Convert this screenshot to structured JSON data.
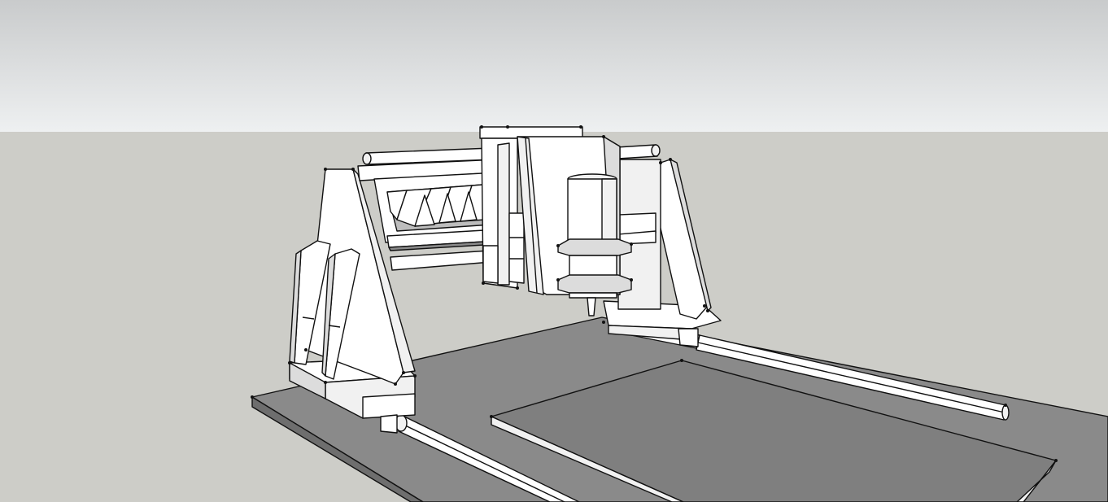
{
  "scene": {
    "subject": "cnc-router-3d-model",
    "colors": {
      "sky_top": "#c9cbcc",
      "sky_bottom": "#eef0f1",
      "ground": "#cdcdc8",
      "base_plate": "#808080",
      "work_table": "#7f7f7f",
      "frame_face": "#ffffff",
      "frame_shade": "#dcdcdc",
      "edges": "#111111"
    }
  }
}
